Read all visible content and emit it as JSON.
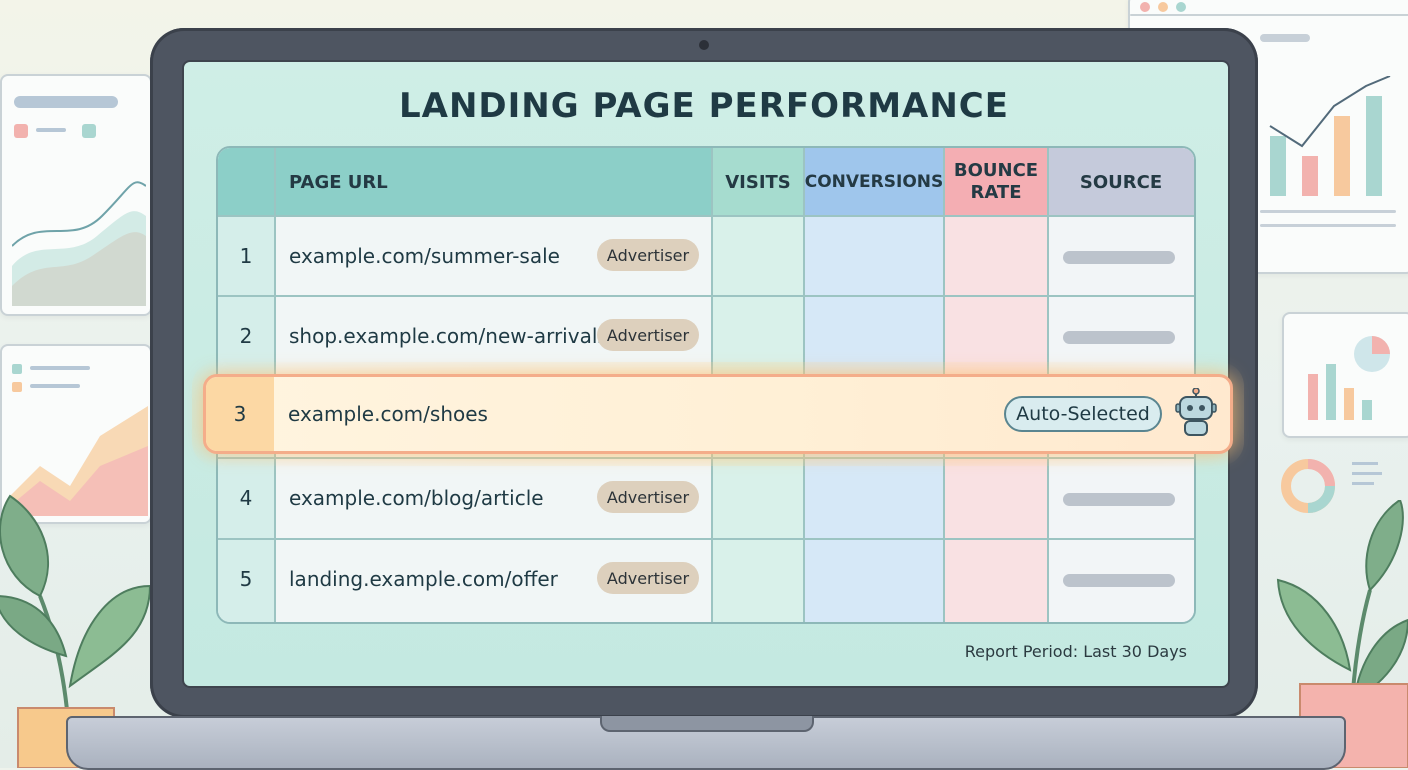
{
  "title": "LANDING PAGE PERFORMANCE",
  "table": {
    "columns": {
      "number": "",
      "page_url": "PAGE URL",
      "visits": "VISITS",
      "conversions": "CONVERSIONS",
      "bounce_rate": "BOUNCE RATE",
      "source": "SOURCE"
    },
    "rows": [
      {
        "n": "1",
        "url": "example.com/summer-sale",
        "badge": "Advertiser"
      },
      {
        "n": "2",
        "url": "shop.example.com/new-arrivals",
        "badge": "Advertiser"
      },
      {
        "n": "3",
        "url": "example.com/shoes",
        "badge": "Auto-Selected",
        "highlighted": true
      },
      {
        "n": "4",
        "url": "example.com/blog/article",
        "badge": "Advertiser"
      },
      {
        "n": "5",
        "url": "landing.example.com/offer",
        "badge": "Advertiser"
      }
    ]
  },
  "footer": "Report Period: Last 30 Days",
  "icons": {
    "selected_row": "robot-icon"
  },
  "colors": {
    "header": "#8ccfc8",
    "highlight_border": "#f4ad8a",
    "badge": "#ddd0bd"
  }
}
